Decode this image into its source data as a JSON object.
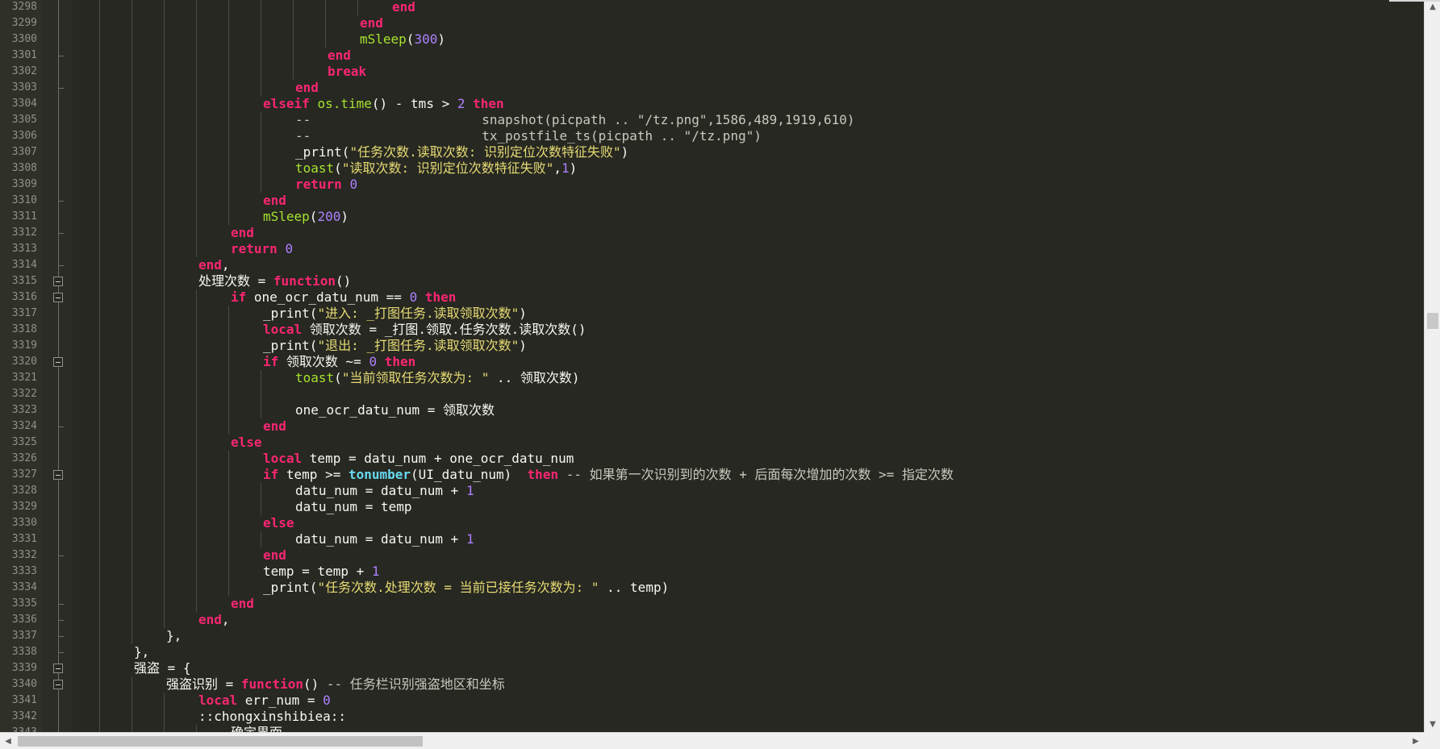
{
  "editor": {
    "lines": [
      {
        "num": "3298",
        "fold": "line",
        "depth": 9,
        "tokens": [
          [
            "kw",
            "end"
          ]
        ]
      },
      {
        "num": "3299",
        "fold": "line",
        "depth": 8,
        "tokens": [
          [
            "kw",
            "end"
          ]
        ]
      },
      {
        "num": "3300",
        "fold": "line",
        "depth": 8,
        "tokens": [
          [
            "fn",
            "mSleep"
          ],
          [
            "pl",
            "("
          ],
          [
            "num",
            "300"
          ],
          [
            "pl",
            ")"
          ]
        ]
      },
      {
        "num": "3301",
        "fold": "tick",
        "depth": 7,
        "tokens": [
          [
            "kw",
            "end"
          ]
        ]
      },
      {
        "num": "3302",
        "fold": "line",
        "depth": 7,
        "tokens": [
          [
            "kw",
            "break"
          ]
        ]
      },
      {
        "num": "3303",
        "fold": "tick",
        "depth": 6,
        "tokens": [
          [
            "kw",
            "end"
          ]
        ]
      },
      {
        "num": "3304",
        "fold": "line",
        "depth": 5,
        "tokens": [
          [
            "kw",
            "elseif "
          ],
          [
            "fn",
            "os.time"
          ],
          [
            "pl",
            "() "
          ],
          [
            "op",
            "- "
          ],
          [
            "pl",
            "tms "
          ],
          [
            "op",
            "> "
          ],
          [
            "num",
            "2 "
          ],
          [
            "kw",
            "then"
          ]
        ]
      },
      {
        "num": "3305",
        "fold": "line",
        "depth": 6,
        "tokens": [
          [
            "cm",
            "--                      snapshot(picpath .. \"/tz.png\",1586,489,1919,610)"
          ]
        ]
      },
      {
        "num": "3306",
        "fold": "line",
        "depth": 6,
        "tokens": [
          [
            "cm",
            "--                      tx_postfile_ts(picpath .. \"/tz.png\")"
          ]
        ]
      },
      {
        "num": "3307",
        "fold": "line",
        "depth": 6,
        "tokens": [
          [
            "pl",
            "_print("
          ],
          [
            "str",
            "\"任务次数.读取次数: 识别定位次数特征失败\""
          ],
          [
            "pl",
            ")"
          ]
        ]
      },
      {
        "num": "3308",
        "fold": "line",
        "depth": 6,
        "tokens": [
          [
            "fn",
            "toast"
          ],
          [
            "pl",
            "("
          ],
          [
            "str",
            "\"读取次数: 识别定位次数特征失败\""
          ],
          [
            "pl",
            ","
          ],
          [
            "num",
            "1"
          ],
          [
            "pl",
            ")"
          ]
        ]
      },
      {
        "num": "3309",
        "fold": "line",
        "depth": 6,
        "tokens": [
          [
            "kw",
            "return "
          ],
          [
            "num",
            "0"
          ]
        ]
      },
      {
        "num": "3310",
        "fold": "tick",
        "depth": 5,
        "tokens": [
          [
            "kw",
            "end"
          ]
        ]
      },
      {
        "num": "3311",
        "fold": "line",
        "depth": 5,
        "tokens": [
          [
            "fn",
            "mSleep"
          ],
          [
            "pl",
            "("
          ],
          [
            "num",
            "200"
          ],
          [
            "pl",
            ")"
          ]
        ]
      },
      {
        "num": "3312",
        "fold": "tick",
        "depth": 4,
        "tokens": [
          [
            "kw",
            "end"
          ]
        ]
      },
      {
        "num": "3313",
        "fold": "line",
        "depth": 4,
        "tokens": [
          [
            "kw",
            "return "
          ],
          [
            "num",
            "0"
          ]
        ]
      },
      {
        "num": "3314",
        "fold": "tick",
        "depth": 3,
        "tokens": [
          [
            "kw",
            "end"
          ],
          [
            "pl",
            ","
          ]
        ]
      },
      {
        "num": "3315",
        "fold": "box",
        "depth": 3,
        "tokens": [
          [
            "pl",
            "处理次数 "
          ],
          [
            "op",
            "= "
          ],
          [
            "kw",
            "function"
          ],
          [
            "pl",
            "()"
          ]
        ]
      },
      {
        "num": "3316",
        "fold": "box",
        "depth": 4,
        "tokens": [
          [
            "kw",
            "if "
          ],
          [
            "pl",
            "one_ocr_datu_num "
          ],
          [
            "op",
            "== "
          ],
          [
            "num",
            "0 "
          ],
          [
            "kw",
            "then"
          ]
        ]
      },
      {
        "num": "3317",
        "fold": "line",
        "depth": 5,
        "tokens": [
          [
            "pl",
            "_print("
          ],
          [
            "str",
            "\"进入: _打图任务.读取领取次数\""
          ],
          [
            "pl",
            ")"
          ]
        ]
      },
      {
        "num": "3318",
        "fold": "line",
        "depth": 5,
        "tokens": [
          [
            "kw",
            "local "
          ],
          [
            "pl",
            "领取次数 "
          ],
          [
            "op",
            "= "
          ],
          [
            "pl",
            "_打图.领取.任务次数.读取次数()"
          ]
        ]
      },
      {
        "num": "3319",
        "fold": "line",
        "depth": 5,
        "tokens": [
          [
            "pl",
            "_print("
          ],
          [
            "str",
            "\"退出: _打图任务.读取领取次数\""
          ],
          [
            "pl",
            ")"
          ]
        ]
      },
      {
        "num": "3320",
        "fold": "box",
        "depth": 5,
        "tokens": [
          [
            "kw",
            "if "
          ],
          [
            "pl",
            "领取次数 "
          ],
          [
            "op",
            "~= "
          ],
          [
            "num",
            "0 "
          ],
          [
            "kw",
            "then"
          ]
        ]
      },
      {
        "num": "3321",
        "fold": "line",
        "depth": 6,
        "tokens": [
          [
            "fn",
            "toast"
          ],
          [
            "pl",
            "("
          ],
          [
            "str",
            "\"当前领取任务次数为: \" "
          ],
          [
            "op",
            ".. "
          ],
          [
            "pl",
            "领取次数)"
          ]
        ]
      },
      {
        "num": "3322",
        "fold": "line",
        "depth": 6,
        "tokens": []
      },
      {
        "num": "3323",
        "fold": "line",
        "depth": 6,
        "tokens": [
          [
            "pl",
            "one_ocr_datu_num "
          ],
          [
            "op",
            "= "
          ],
          [
            "pl",
            "领取次数"
          ]
        ]
      },
      {
        "num": "3324",
        "fold": "tick",
        "depth": 5,
        "tokens": [
          [
            "kw",
            "end"
          ]
        ]
      },
      {
        "num": "3325",
        "fold": "line",
        "depth": 4,
        "tokens": [
          [
            "kw",
            "else"
          ]
        ]
      },
      {
        "num": "3326",
        "fold": "line",
        "depth": 5,
        "tokens": [
          [
            "kw",
            "local "
          ],
          [
            "pl",
            "temp "
          ],
          [
            "op",
            "= "
          ],
          [
            "pl",
            "datu_num "
          ],
          [
            "op",
            "+ "
          ],
          [
            "pl",
            "one_ocr_datu_num"
          ]
        ]
      },
      {
        "num": "3327",
        "fold": "box",
        "depth": 5,
        "tokens": [
          [
            "kw",
            "if "
          ],
          [
            "pl",
            "temp "
          ],
          [
            "op",
            ">= "
          ],
          [
            "fnb",
            "tonumber"
          ],
          [
            "pl",
            "(UI_datu_num)  "
          ],
          [
            "kw",
            "then "
          ],
          [
            "cm",
            "-- 如果第一次识别到的次数 + 后面每次增加的次数 >= 指定次数"
          ]
        ]
      },
      {
        "num": "3328",
        "fold": "line",
        "depth": 6,
        "tokens": [
          [
            "pl",
            "datu_num "
          ],
          [
            "op",
            "= "
          ],
          [
            "pl",
            "datu_num "
          ],
          [
            "op",
            "+ "
          ],
          [
            "num",
            "1"
          ]
        ]
      },
      {
        "num": "3329",
        "fold": "line",
        "depth": 6,
        "tokens": [
          [
            "pl",
            "datu_num "
          ],
          [
            "op",
            "= "
          ],
          [
            "pl",
            "temp"
          ]
        ]
      },
      {
        "num": "3330",
        "fold": "line",
        "depth": 5,
        "tokens": [
          [
            "kw",
            "else"
          ]
        ]
      },
      {
        "num": "3331",
        "fold": "line",
        "depth": 6,
        "tokens": [
          [
            "pl",
            "datu_num "
          ],
          [
            "op",
            "= "
          ],
          [
            "pl",
            "datu_num "
          ],
          [
            "op",
            "+ "
          ],
          [
            "num",
            "1"
          ]
        ]
      },
      {
        "num": "3332",
        "fold": "tick",
        "depth": 5,
        "tokens": [
          [
            "kw",
            "end"
          ]
        ]
      },
      {
        "num": "3333",
        "fold": "line",
        "depth": 5,
        "tokens": [
          [
            "pl",
            "temp "
          ],
          [
            "op",
            "= "
          ],
          [
            "pl",
            "temp "
          ],
          [
            "op",
            "+ "
          ],
          [
            "num",
            "1"
          ]
        ]
      },
      {
        "num": "3334",
        "fold": "line",
        "depth": 5,
        "tokens": [
          [
            "pl",
            "_print("
          ],
          [
            "str",
            "\"任务次数.处理次数 = 当前已接任务次数为: \" "
          ],
          [
            "op",
            ".. "
          ],
          [
            "pl",
            "temp)"
          ]
        ]
      },
      {
        "num": "3335",
        "fold": "tick",
        "depth": 4,
        "tokens": [
          [
            "kw",
            "end"
          ]
        ]
      },
      {
        "num": "3336",
        "fold": "tick",
        "depth": 3,
        "tokens": [
          [
            "kw",
            "end"
          ],
          [
            "pl",
            ","
          ]
        ]
      },
      {
        "num": "3337",
        "fold": "tick",
        "depth": 2,
        "tokens": [
          [
            "pl",
            "},"
          ]
        ]
      },
      {
        "num": "3338",
        "fold": "tick",
        "depth": 1,
        "tokens": [
          [
            "pl",
            "},"
          ]
        ]
      },
      {
        "num": "3339",
        "fold": "box",
        "depth": 1,
        "tokens": [
          [
            "pl",
            "强盗 "
          ],
          [
            "op",
            "= "
          ],
          [
            "pl",
            "{"
          ]
        ]
      },
      {
        "num": "3340",
        "fold": "box",
        "depth": 2,
        "tokens": [
          [
            "pl",
            "强盗识别 "
          ],
          [
            "op",
            "= "
          ],
          [
            "kw",
            "function"
          ],
          [
            "pl",
            "() "
          ],
          [
            "cm",
            "-- 任务栏识别强盗地区和坐标"
          ]
        ]
      },
      {
        "num": "3341",
        "fold": "line",
        "depth": 3,
        "tokens": [
          [
            "kw",
            "local "
          ],
          [
            "pl",
            "err_num "
          ],
          [
            "op",
            "= "
          ],
          [
            "num",
            "0"
          ]
        ]
      },
      {
        "num": "3342",
        "fold": "line",
        "depth": 3,
        "tokens": [
          [
            "pl",
            "::chongxinshibiea::"
          ]
        ]
      },
      {
        "num": "3343",
        "fold": "line",
        "depth": 4,
        "tokens": [
          [
            "pl",
            "确定界面"
          ]
        ]
      }
    ]
  },
  "scrollbars": {
    "up_arrow": "▲",
    "down_arrow": "▼",
    "left_arrow": "◀",
    "right_arrow": "▶"
  },
  "colors": {
    "background": "#272822",
    "keyword": "#f92672",
    "function": "#a6e22e",
    "number": "#ae81ff",
    "string": "#e6db74"
  }
}
